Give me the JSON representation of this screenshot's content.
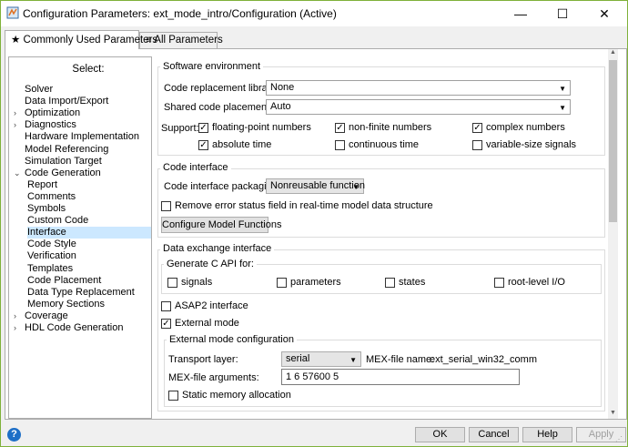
{
  "window": {
    "title": "Configuration Parameters: ext_mode_intro/Configuration (Active)",
    "minimize": "—",
    "maximize": "☐",
    "close": "✕"
  },
  "tabs": [
    {
      "icon": "★",
      "label": "Commonly Used Parameters"
    },
    {
      "icon": "≡",
      "label": "All Parameters"
    }
  ],
  "tree": {
    "header": "Select:",
    "items": [
      {
        "label": "Solver",
        "level": 0,
        "arrow": ""
      },
      {
        "label": "Data Import/Export",
        "level": 0,
        "arrow": ""
      },
      {
        "label": "Optimization",
        "level": 0,
        "arrow": "›"
      },
      {
        "label": "Diagnostics",
        "level": 0,
        "arrow": "›"
      },
      {
        "label": "Hardware Implementation",
        "level": 0,
        "arrow": ""
      },
      {
        "label": "Model Referencing",
        "level": 0,
        "arrow": ""
      },
      {
        "label": "Simulation Target",
        "level": 0,
        "arrow": ""
      },
      {
        "label": "Code Generation",
        "level": 0,
        "arrow": "⌄"
      },
      {
        "label": "Report",
        "level": 1,
        "arrow": ""
      },
      {
        "label": "Comments",
        "level": 1,
        "arrow": ""
      },
      {
        "label": "Symbols",
        "level": 1,
        "arrow": ""
      },
      {
        "label": "Custom Code",
        "level": 1,
        "arrow": ""
      },
      {
        "label": "Interface",
        "level": 1,
        "arrow": "",
        "selected": true
      },
      {
        "label": "Code Style",
        "level": 1,
        "arrow": ""
      },
      {
        "label": "Verification",
        "level": 1,
        "arrow": ""
      },
      {
        "label": "Templates",
        "level": 1,
        "arrow": ""
      },
      {
        "label": "Code Placement",
        "level": 1,
        "arrow": ""
      },
      {
        "label": "Data Type Replacement",
        "level": 1,
        "arrow": ""
      },
      {
        "label": "Memory Sections",
        "level": 1,
        "arrow": ""
      },
      {
        "label": "Coverage",
        "level": 0,
        "arrow": "›"
      },
      {
        "label": "HDL Code Generation",
        "level": 0,
        "arrow": "›"
      }
    ]
  },
  "software_env": {
    "title": "Software environment",
    "code_repl_label": "Code replacement library:",
    "code_repl_value": "None",
    "shared_label": "Shared code placement:",
    "shared_value": "Auto",
    "support_label": "Support:",
    "checks": [
      {
        "label": "floating-point numbers",
        "checked": true
      },
      {
        "label": "non-finite numbers",
        "checked": true
      },
      {
        "label": "complex numbers",
        "checked": true
      },
      {
        "label": "absolute time",
        "checked": true
      },
      {
        "label": "continuous time",
        "checked": false
      },
      {
        "label": "variable-size signals",
        "checked": false
      }
    ]
  },
  "code_interface": {
    "title": "Code interface",
    "packaging_label": "Code interface packaging:",
    "packaging_value": "Nonreusable function",
    "remove_error_label": "Remove error status field in real-time model data structure",
    "remove_error_checked": false,
    "configure_button": "Configure Model Functions"
  },
  "data_exchange": {
    "title": "Data exchange interface",
    "c_api_title": "Generate C API for:",
    "c_api": [
      {
        "label": "signals",
        "checked": false
      },
      {
        "label": "parameters",
        "checked": false
      },
      {
        "label": "states",
        "checked": false
      },
      {
        "label": "root-level I/O",
        "checked": false
      }
    ],
    "asap2_label": "ASAP2 interface",
    "asap2_checked": false,
    "external_mode_label": "External mode",
    "external_mode_checked": true,
    "ext_config": {
      "title": "External mode configuration",
      "transport_label": "Transport layer:",
      "transport_value": "serial",
      "mex_name_label": "MEX-file name:",
      "mex_name_value": "ext_serial_win32_comm",
      "mex_args_label": "MEX-file arguments:",
      "mex_args_value": "1 6 57600 5",
      "static_mem_label": "Static memory allocation",
      "static_mem_checked": false
    }
  },
  "buttons": {
    "ok": "OK",
    "cancel": "Cancel",
    "help": "Help",
    "apply": "Apply"
  },
  "colors": {
    "selection": "#cce8ff",
    "window_border": "#7fb13a",
    "help_icon": "#1e6fc7"
  }
}
